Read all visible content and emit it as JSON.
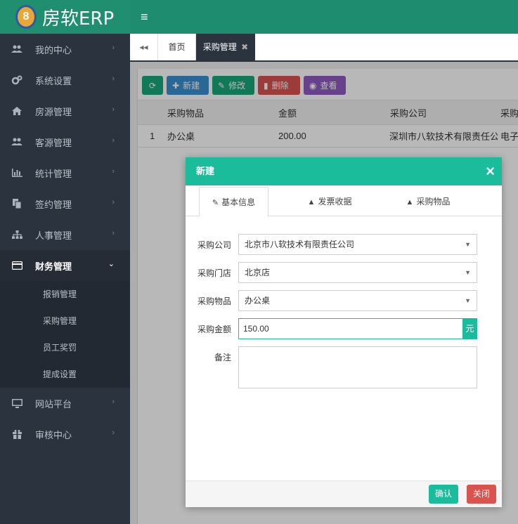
{
  "app": {
    "logo_number": "8",
    "title": "房软ERP"
  },
  "sidebar": {
    "items": [
      {
        "label": "我的中心",
        "icon": "users-icon",
        "glyph": "●●"
      },
      {
        "label": "系统设置",
        "icon": "cogs-icon",
        "glyph": "✲"
      },
      {
        "label": "房源管理",
        "icon": "home-icon",
        "glyph": "⌂"
      },
      {
        "label": "客源管理",
        "icon": "users-icon",
        "glyph": "●●"
      },
      {
        "label": "统计管理",
        "icon": "bar-chart-icon",
        "glyph": "▥"
      },
      {
        "label": "签约管理",
        "icon": "copy-icon",
        "glyph": "❐"
      },
      {
        "label": "人事管理",
        "icon": "sitemap-icon",
        "glyph": "⊥"
      },
      {
        "label": "财务管理",
        "icon": "credit-card-icon",
        "glyph": "▭"
      },
      {
        "label": "网站平台",
        "icon": "desktop-icon",
        "glyph": "▭"
      },
      {
        "label": "审核中心",
        "icon": "gift-icon",
        "glyph": "✚"
      }
    ],
    "finance_sub": [
      "报销管理",
      "采购管理",
      "员工奖罚",
      "提成设置"
    ]
  },
  "tabs": {
    "home": "首页",
    "active": "采购管理"
  },
  "toolbar": {
    "new": "新建",
    "edit": "修改",
    "delete": "删除",
    "view": "查看"
  },
  "grid": {
    "columns": [
      "采购物品",
      "金额",
      "采购公司",
      "采购"
    ],
    "rows": [
      {
        "index": "1",
        "item": "办公桌",
        "amount": "200.00",
        "company": "深圳市八软技术有限责任公司",
        "extra": "电子"
      }
    ]
  },
  "modal": {
    "title": "新建",
    "tabs": [
      "基本信息",
      "发票收据",
      "采购物品"
    ],
    "fields": {
      "company": {
        "label": "采购公司",
        "value": "北京市八软技术有限责任公司"
      },
      "store": {
        "label": "采购门店",
        "value": "北京店"
      },
      "item": {
        "label": "采购物品",
        "value": "办公桌"
      },
      "amount": {
        "label": "采购金额",
        "value": "150.00",
        "unit": "元"
      },
      "note": {
        "label": "备注",
        "value": ""
      }
    },
    "ok": "确认",
    "close": "关闭"
  }
}
